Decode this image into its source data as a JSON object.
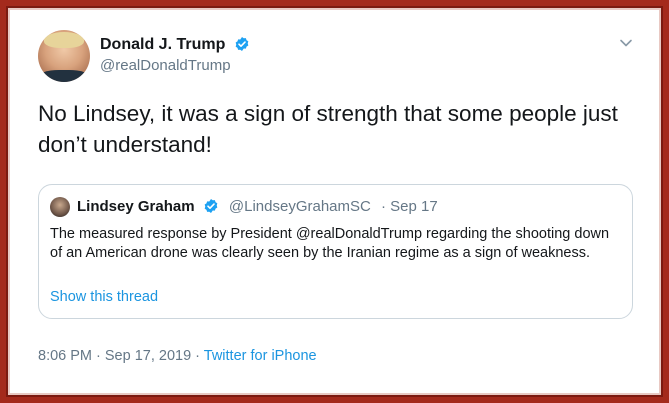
{
  "tweet": {
    "author_name": "Donald J. Trump",
    "author_handle": "@realDonaldTrump",
    "text": "No Lindsey, it was a sign of strength that some people just don’t understand!",
    "timestamp": "8:06 PM · Sep 17, 2019",
    "separator": " · ",
    "source": "Twitter for iPhone",
    "verified_icon": "verified-badge-icon",
    "menu_icon": "chevron-down-icon"
  },
  "quoted_tweet": {
    "author_name": "Lindsey Graham",
    "author_handle": "@LindseyGrahamSC",
    "date": "· Sep 17",
    "text": "The measured response by President @realDonaldTrump regarding the shooting down of an American drone was clearly seen by the Iranian regime as a sign of weakness.",
    "show_thread_label": "Show this thread"
  },
  "colors": {
    "frame": "#a42a1c",
    "link": "#1b95e0",
    "secondary_text": "#657786",
    "verified": "#1da1f2"
  }
}
